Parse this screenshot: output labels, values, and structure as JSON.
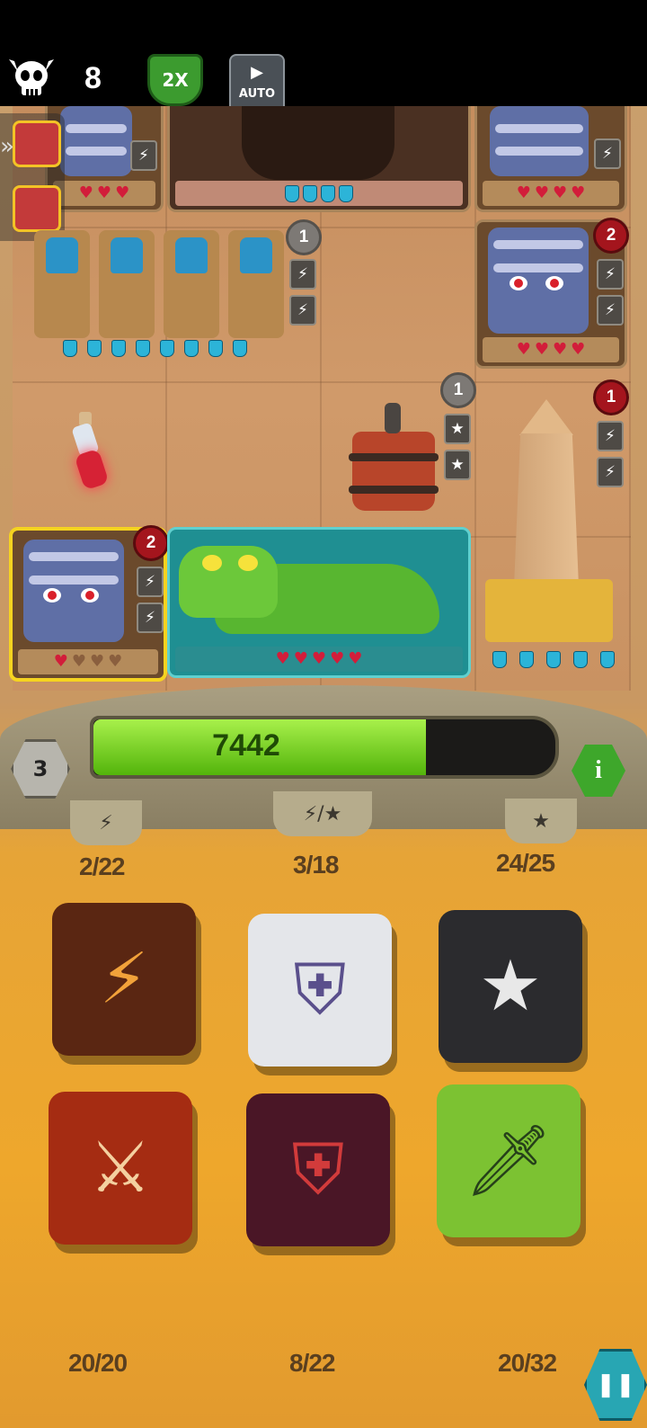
{
  "hud": {
    "skull_count": "8",
    "speed_label": "2X",
    "auto_label": "AUTO",
    "play_glyph": "▶",
    "icons": [
      "skull-icon",
      "chest-icon",
      "chest-icon",
      "expand-icon"
    ]
  },
  "board": {
    "cards": [
      {
        "name": "mummy-top-left",
        "hearts_full": 3,
        "hearts_empty": 0
      },
      {
        "name": "stone-gate",
        "shields": 4
      },
      {
        "name": "mummy-top-right",
        "hearts_full": 4,
        "hearts_empty": 0
      },
      {
        "name": "pharaoh-guards",
        "shields": 8,
        "badge": "1"
      },
      {
        "name": "mummy-right",
        "hearts_full": 4,
        "hearts_empty": 0,
        "badge": "2"
      },
      {
        "name": "potion",
        "badge": ""
      },
      {
        "name": "powder-keg",
        "badge": "1"
      },
      {
        "name": "obelisk",
        "shields": 5,
        "badge": "1"
      },
      {
        "name": "mummy-selected",
        "hearts_full": 1,
        "hearts_empty": 3,
        "badge": "2"
      },
      {
        "name": "crocodile",
        "hearts_full": 5,
        "hearts_empty": 0
      }
    ]
  },
  "progress": {
    "score": "7442",
    "fill_percent": 72,
    "level": "3",
    "info_glyph": "i"
  },
  "counters": {
    "bolt_symbol": "⚡",
    "bolt_star_symbol": "⚡/★",
    "star_symbol": "★",
    "bolt": "2/22",
    "bolt_star": "3/18",
    "star": "24/25",
    "bottom_left": "20/20",
    "bottom_mid": "8/22",
    "bottom_right": "20/32"
  },
  "dice": [
    {
      "name": "fire-bolt-die",
      "glyph": "⚡",
      "color": "#5a2612"
    },
    {
      "name": "white-shield-die",
      "glyph": "⛨",
      "color": "#e4e6ea"
    },
    {
      "name": "black-star-die",
      "glyph": "★",
      "color": "#2b2b2e"
    },
    {
      "name": "fire-sword-die",
      "glyph": "⚔",
      "color": "#a52c12"
    },
    {
      "name": "dark-shield-die",
      "glyph": "⛨",
      "color": "#4a1626"
    },
    {
      "name": "green-sword-die",
      "glyph": "🗡",
      "color": "#7cc232"
    }
  ],
  "pause_glyph": "❚❚",
  "colors": {
    "accent_green": "#7de022",
    "heart_red": "#d21d3a",
    "shield_blue": "#2cb4d8"
  }
}
